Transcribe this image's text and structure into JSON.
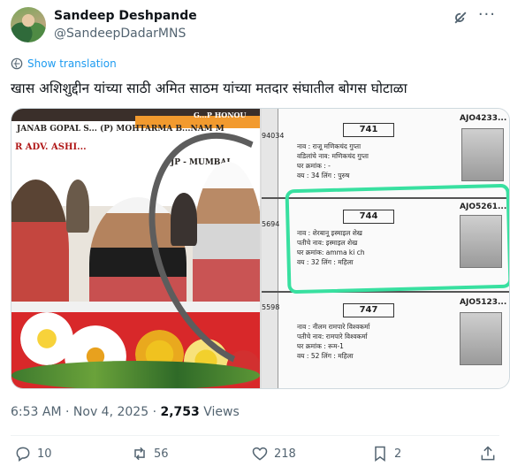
{
  "author": {
    "name": "Sandeep Deshpande",
    "handle": "@SandeepDadarMNS"
  },
  "translate_label": "Show translation",
  "tweet_text": "खास अशिशुद्दीन यांच्या साठी अमित साठम यांच्या मतदार संघातील बोगस घोटाळा",
  "media": {
    "left": {
      "banner_line1": "JANAB GOPAL S... (P) MOHTARMA B...NAM M",
      "banner_line2": "R ADV. ASHI...",
      "banner_line3": "JP - MUMBAI",
      "banner_tag": "G...P HONOU"
    },
    "right": {
      "cards": [
        {
          "number": "741",
          "epic": "AJO4233...",
          "left_number": "94034",
          "lines": [
            "नाव : राजू मणिकचंद गुप्ता",
            "वडिलांचे नाव: मणिकचंद गुप्ता",
            "घर क्रमांक : -",
            "वय : 34  लिंग : पुरुष"
          ]
        },
        {
          "number": "744",
          "epic": "AJO5261...",
          "left_number": "5694",
          "lines": [
            "नाव : शेरबानू इस्माइल शेख",
            "पतीचे नाव: इस्माइल शेख",
            "घर क्रमांक: amma ki ch",
            "वय : 32  लिंग : महिला"
          ]
        },
        {
          "number": "747",
          "epic": "AJO5123...",
          "left_number": "5598",
          "lines": [
            "नाव : नीलम रामपारे विश्वकर्मा",
            "पतीचे नाव: रामपारे विश्वकर्मा",
            "घर क्रमांक : रूम-1",
            "वय : 52  लिंग : महिला"
          ]
        }
      ]
    }
  },
  "timestamp": {
    "time": "6:53 AM",
    "date": "Nov 4, 2025",
    "views_count": "2,753",
    "views_label": "Views"
  },
  "actions": {
    "replies": "10",
    "reposts": "56",
    "likes": "218",
    "bookmarks": "2"
  },
  "colors": {
    "accent": "#1d9bf0",
    "muted": "#536471",
    "highlight": "#38e0a0"
  },
  "icons": [
    "grok-icon",
    "more-icon",
    "translate-icon",
    "reply-icon",
    "repost-icon",
    "like-icon",
    "bookmark-icon",
    "share-icon"
  ]
}
